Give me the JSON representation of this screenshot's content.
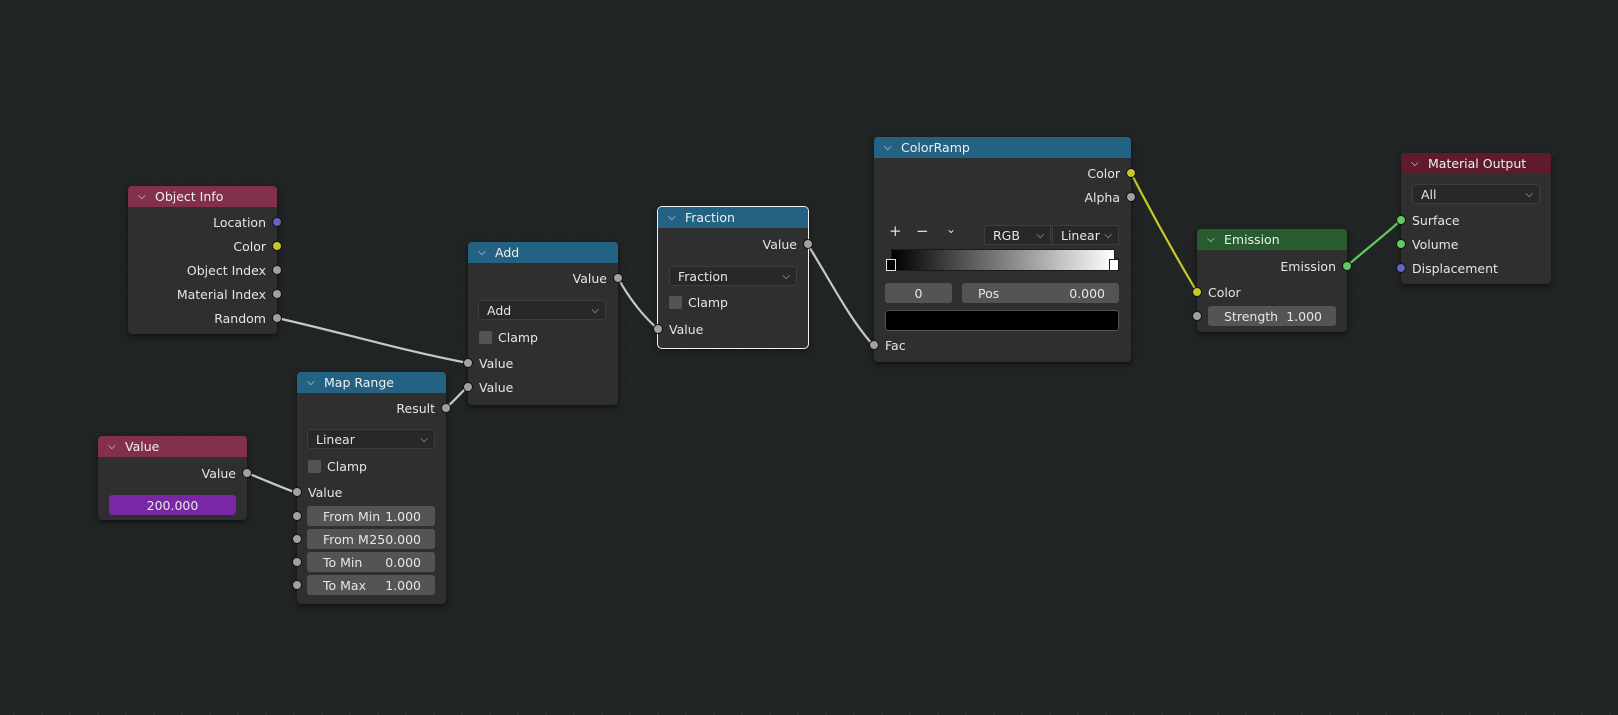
{
  "nodes": {
    "object_info": {
      "title": "Object Info",
      "outputs": [
        "Location",
        "Color",
        "Object Index",
        "Material Index",
        "Random"
      ]
    },
    "value": {
      "title": "Value",
      "output": "Value",
      "field_value": "200.000"
    },
    "map_range": {
      "title": "Map Range",
      "output": "Result",
      "interpolation": "Linear",
      "clamp_label": "Clamp",
      "input_value": "Value",
      "from_min_label": "From Min",
      "from_min_value": "1.000",
      "from_max_label": "From M",
      "from_max_value": "250.000",
      "to_min_label": "To Min",
      "to_min_value": "0.000",
      "to_max_label": "To Max",
      "to_max_value": "1.000"
    },
    "add": {
      "title": "Add",
      "output": "Value",
      "operation": "Add",
      "clamp_label": "Clamp",
      "input1": "Value",
      "input2": "Value"
    },
    "fraction": {
      "title": "Fraction",
      "output": "Value",
      "operation": "Fraction",
      "clamp_label": "Clamp",
      "input": "Value"
    },
    "colorramp": {
      "title": "ColorRamp",
      "output_color": "Color",
      "output_alpha": "Alpha",
      "add_icon": "+",
      "remove_icon": "−",
      "menu_icon": "⌄",
      "color_mode": "RGB",
      "interpolation": "Linear",
      "stop_index": "0",
      "pos_label": "Pos",
      "pos_value": "0.000",
      "input_fac": "Fac"
    },
    "emission": {
      "title": "Emission",
      "output": "Emission",
      "input_color": "Color",
      "strength_label": "Strength",
      "strength_value": "1.000"
    },
    "material_output": {
      "title": "Material Output",
      "target": "All",
      "inputs": [
        "Surface",
        "Volume",
        "Displacement"
      ]
    }
  },
  "colors": {
    "input_header": "#83314a",
    "converter_header": "#246283",
    "shader_header": "#285b2d",
    "output_header": "#5e1c2a",
    "value_field": "#7a27a6",
    "socket_float": "#a1a1a1",
    "socket_color": "#c7c729",
    "socket_vector": "#6363c7",
    "socket_shader": "#63c763"
  }
}
